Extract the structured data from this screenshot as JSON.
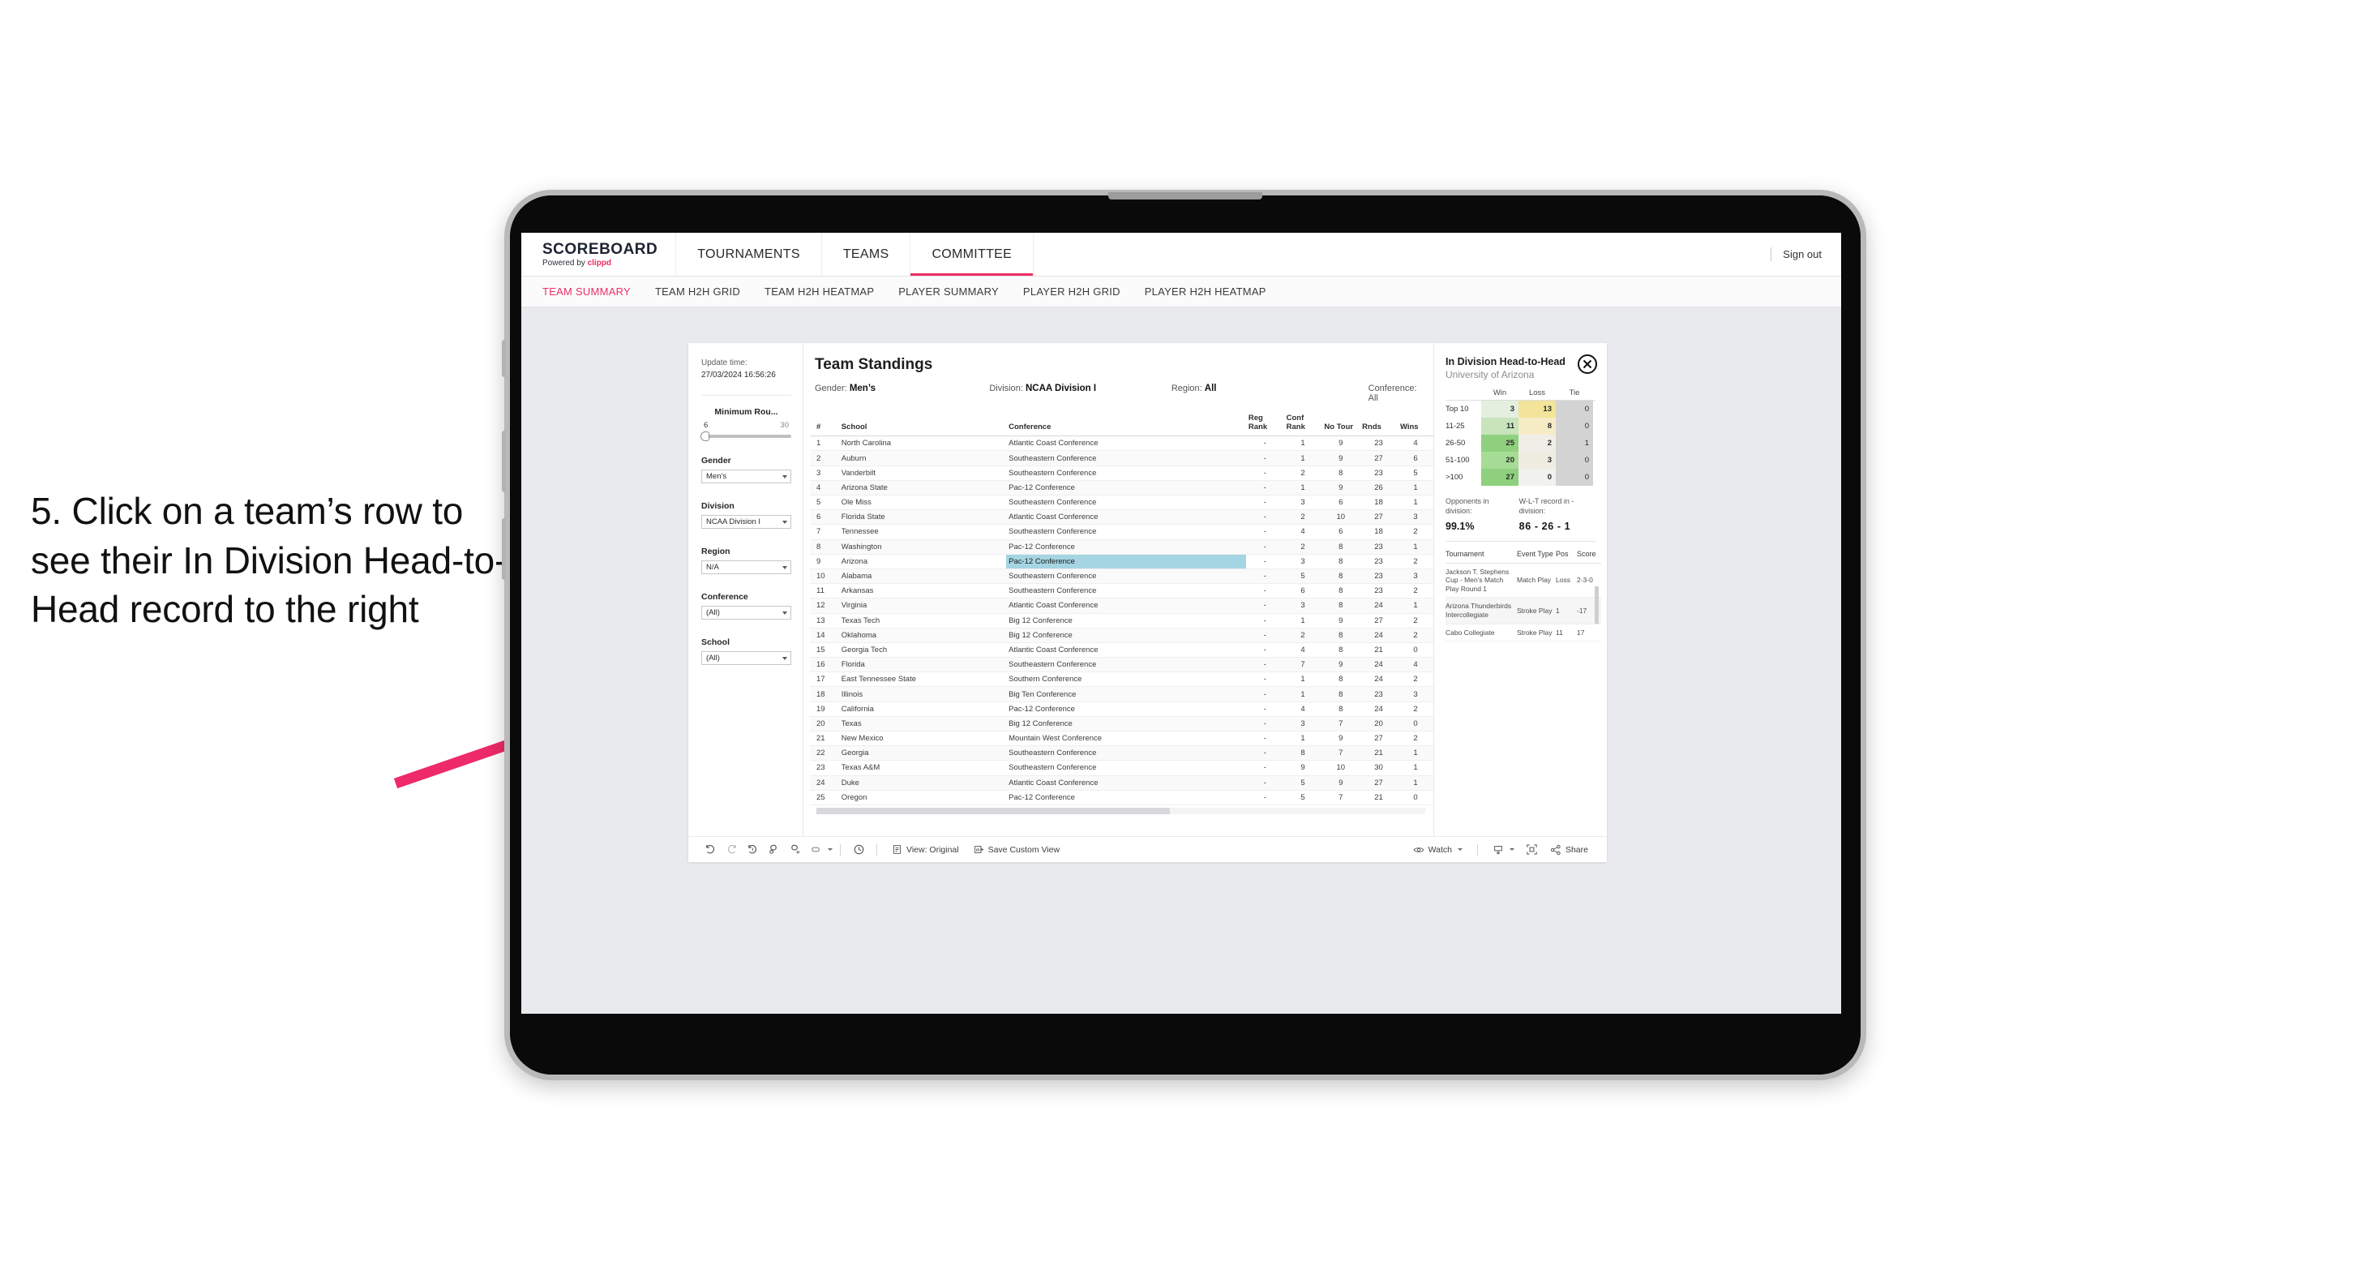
{
  "annotation": {
    "text": "5. Click on a team’s row to see their In Division Head-to-Head record to the right",
    "arrow_color": "#ee2a68"
  },
  "app": {
    "brand": {
      "title": "SCOREBOARD",
      "powered_prefix": "Powered by ",
      "powered_name": "clippd"
    },
    "topnav": [
      {
        "label": "TOURNAMENTS",
        "active": false
      },
      {
        "label": "TEAMS",
        "active": false
      },
      {
        "label": "COMMITTEE",
        "active": true
      }
    ],
    "sign_out": "Sign out",
    "subtabs": [
      {
        "label": "TEAM SUMMARY",
        "active": true
      },
      {
        "label": "TEAM H2H GRID",
        "active": false
      },
      {
        "label": "TEAM H2H HEATMAP",
        "active": false
      },
      {
        "label": "PLAYER SUMMARY",
        "active": false
      },
      {
        "label": "PLAYER H2H GRID",
        "active": false
      },
      {
        "label": "PLAYER H2H HEATMAP",
        "active": false
      }
    ]
  },
  "filters": {
    "update_time_label": "Update time:",
    "update_time_value": "27/03/2024 16:56:26",
    "minimum_rounds": {
      "title": "Minimum Rou...",
      "min": "6",
      "max": "30"
    },
    "gender": {
      "title": "Gender",
      "value": "Men’s"
    },
    "division": {
      "title": "Division",
      "value": "NCAA Division I"
    },
    "region": {
      "title": "Region",
      "value": "N/A"
    },
    "conference": {
      "title": "Conference",
      "value": "(All)"
    },
    "school": {
      "title": "School",
      "value": "(All)"
    }
  },
  "standings": {
    "title": "Team Standings",
    "meta": [
      {
        "label": "Gender: ",
        "value": "Men’s"
      },
      {
        "label": "Division: ",
        "value": "NCAA Division I"
      },
      {
        "label": "Region: ",
        "value": "All"
      },
      {
        "label": "Conference: ",
        "value": "All"
      }
    ],
    "columns": [
      "#",
      "School",
      "Conference",
      "Reg Rank",
      "Conf Rank",
      "No Tour",
      "Rnds",
      "Wins"
    ],
    "rows": [
      {
        "n": "1",
        "school": "North Carolina",
        "conf": "Atlantic Coast Conference",
        "reg": "-",
        "cr": "1",
        "nt": "9",
        "rn": "23",
        "w": "4",
        "selected": false
      },
      {
        "n": "2",
        "school": "Auburn",
        "conf": "Southeastern Conference",
        "reg": "-",
        "cr": "1",
        "nt": "9",
        "rn": "27",
        "w": "6",
        "selected": false
      },
      {
        "n": "3",
        "school": "Vanderbilt",
        "conf": "Southeastern Conference",
        "reg": "-",
        "cr": "2",
        "nt": "8",
        "rn": "23",
        "w": "5",
        "selected": false
      },
      {
        "n": "4",
        "school": "Arizona State",
        "conf": "Pac-12 Conference",
        "reg": "-",
        "cr": "1",
        "nt": "9",
        "rn": "26",
        "w": "1",
        "selected": false
      },
      {
        "n": "5",
        "school": "Ole Miss",
        "conf": "Southeastern Conference",
        "reg": "-",
        "cr": "3",
        "nt": "6",
        "rn": "18",
        "w": "1",
        "selected": false
      },
      {
        "n": "6",
        "school": "Florida State",
        "conf": "Atlantic Coast Conference",
        "reg": "-",
        "cr": "2",
        "nt": "10",
        "rn": "27",
        "w": "3",
        "selected": false
      },
      {
        "n": "7",
        "school": "Tennessee",
        "conf": "Southeastern Conference",
        "reg": "-",
        "cr": "4",
        "nt": "6",
        "rn": "18",
        "w": "2",
        "selected": false
      },
      {
        "n": "8",
        "school": "Washington",
        "conf": "Pac-12 Conference",
        "reg": "-",
        "cr": "2",
        "nt": "8",
        "rn": "23",
        "w": "1",
        "selected": false
      },
      {
        "n": "9",
        "school": "Arizona",
        "conf": "Pac-12 Conference",
        "reg": "-",
        "cr": "3",
        "nt": "8",
        "rn": "23",
        "w": "2",
        "selected": true
      },
      {
        "n": "10",
        "school": "Alabama",
        "conf": "Southeastern Conference",
        "reg": "-",
        "cr": "5",
        "nt": "8",
        "rn": "23",
        "w": "3",
        "selected": false
      },
      {
        "n": "11",
        "school": "Arkansas",
        "conf": "Southeastern Conference",
        "reg": "-",
        "cr": "6",
        "nt": "8",
        "rn": "23",
        "w": "2",
        "selected": false
      },
      {
        "n": "12",
        "school": "Virginia",
        "conf": "Atlantic Coast Conference",
        "reg": "-",
        "cr": "3",
        "nt": "8",
        "rn": "24",
        "w": "1",
        "selected": false
      },
      {
        "n": "13",
        "school": "Texas Tech",
        "conf": "Big 12 Conference",
        "reg": "-",
        "cr": "1",
        "nt": "9",
        "rn": "27",
        "w": "2",
        "selected": false
      },
      {
        "n": "14",
        "school": "Oklahoma",
        "conf": "Big 12 Conference",
        "reg": "-",
        "cr": "2",
        "nt": "8",
        "rn": "24",
        "w": "2",
        "selected": false
      },
      {
        "n": "15",
        "school": "Georgia Tech",
        "conf": "Atlantic Coast Conference",
        "reg": "-",
        "cr": "4",
        "nt": "8",
        "rn": "21",
        "w": "0",
        "selected": false
      },
      {
        "n": "16",
        "school": "Florida",
        "conf": "Southeastern Conference",
        "reg": "-",
        "cr": "7",
        "nt": "9",
        "rn": "24",
        "w": "4",
        "selected": false
      },
      {
        "n": "17",
        "school": "East Tennessee State",
        "conf": "Southern Conference",
        "reg": "-",
        "cr": "1",
        "nt": "8",
        "rn": "24",
        "w": "2",
        "selected": false
      },
      {
        "n": "18",
        "school": "Illinois",
        "conf": "Big Ten Conference",
        "reg": "-",
        "cr": "1",
        "nt": "8",
        "rn": "23",
        "w": "3",
        "selected": false
      },
      {
        "n": "19",
        "school": "California",
        "conf": "Pac-12 Conference",
        "reg": "-",
        "cr": "4",
        "nt": "8",
        "rn": "24",
        "w": "2",
        "selected": false
      },
      {
        "n": "20",
        "school": "Texas",
        "conf": "Big 12 Conference",
        "reg": "-",
        "cr": "3",
        "nt": "7",
        "rn": "20",
        "w": "0",
        "selected": false
      },
      {
        "n": "21",
        "school": "New Mexico",
        "conf": "Mountain West Conference",
        "reg": "-",
        "cr": "1",
        "nt": "9",
        "rn": "27",
        "w": "2",
        "selected": false
      },
      {
        "n": "22",
        "school": "Georgia",
        "conf": "Southeastern Conference",
        "reg": "-",
        "cr": "8",
        "nt": "7",
        "rn": "21",
        "w": "1",
        "selected": false
      },
      {
        "n": "23",
        "school": "Texas A&M",
        "conf": "Southeastern Conference",
        "reg": "-",
        "cr": "9",
        "nt": "10",
        "rn": "30",
        "w": "1",
        "selected": false
      },
      {
        "n": "24",
        "school": "Duke",
        "conf": "Atlantic Coast Conference",
        "reg": "-",
        "cr": "5",
        "nt": "9",
        "rn": "27",
        "w": "1",
        "selected": false
      },
      {
        "n": "25",
        "school": "Oregon",
        "conf": "Pac-12 Conference",
        "reg": "-",
        "cr": "5",
        "nt": "7",
        "rn": "21",
        "w": "0",
        "selected": false
      }
    ]
  },
  "h2h": {
    "title": "In Division Head-to-Head",
    "subtitle": "University of Arizona",
    "close_icon": "close-icon",
    "heatmap_columns": [
      "Win",
      "Loss",
      "Tie"
    ],
    "heatmap_rows": [
      {
        "label": "Top 10",
        "win": "3",
        "loss": "13",
        "tie": "0",
        "win_color": "#e4efe0",
        "loss_color": "#f2e49a"
      },
      {
        "label": "11-25",
        "win": "11",
        "loss": "8",
        "tie": "0",
        "win_color": "#c7e4bb",
        "loss_color": "#f5ecc6"
      },
      {
        "label": "26-50",
        "win": "25",
        "loss": "2",
        "tie": "1",
        "win_color": "#8fd07f",
        "loss_color": "#f0eee6"
      },
      {
        "label": "51-100",
        "win": "20",
        "loss": "3",
        "tie": "0",
        "win_color": "#a6dc95",
        "loss_color": "#efece2"
      },
      {
        "label": ">100",
        "win": "27",
        "loss": "0",
        "tie": "0",
        "win_color": "#8ed07e",
        "loss_color": "#f1f1ef"
      }
    ],
    "kpis": [
      {
        "label": "Opponents in division:",
        "value": "99.1%"
      },
      {
        "label": "W-L-T record in -division:",
        "value": "86 - 26 - 1"
      }
    ],
    "tournament_columns": [
      "Tournament",
      "Event Type",
      "Pos",
      "Score"
    ],
    "tournaments": [
      {
        "name": "Jackson T. Stephens Cup - Men’s Match Play Round 1",
        "type": "Match Play",
        "pos": "Loss",
        "score": "2-3-0"
      },
      {
        "name": "Arizona Thunderbirds Intercollegiate",
        "type": "Stroke Play",
        "pos": "1",
        "score": "-17"
      },
      {
        "name": "Cabo Collegiate",
        "type": "Stroke Play",
        "pos": "11",
        "score": "17"
      }
    ]
  },
  "toolbar": {
    "icons": [
      "undo-icon",
      "redo-icon",
      "revert-icon",
      "refresh-icon",
      "pause-icon",
      "device-layout-icon"
    ],
    "clock_icon": "clock-icon",
    "view_label": "View: Original",
    "save_label": "Save Custom View",
    "watch_label": "Watch",
    "download_icon": "download-icon",
    "fullscreen_icon": "fullscreen-icon",
    "share_label": "Share"
  }
}
